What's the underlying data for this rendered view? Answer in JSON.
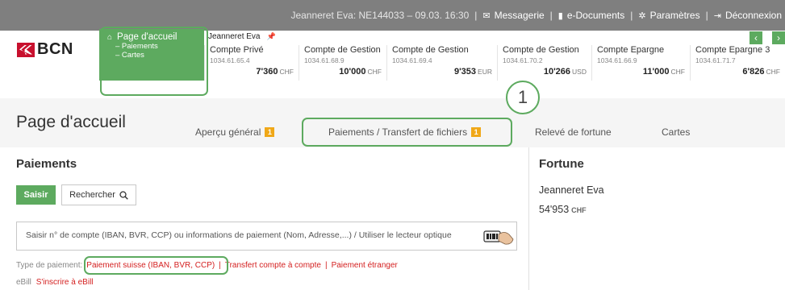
{
  "topbar": {
    "user_info": "Jeanneret Eva:  NE144033 – 09.03. 16:30",
    "separator": "|",
    "links": [
      {
        "icon": "envelope-icon",
        "label": "Messagerie"
      },
      {
        "icon": "document-icon",
        "label": "e-Documents"
      },
      {
        "icon": "gear-icon",
        "label": "Paramètres"
      },
      {
        "icon": "logout-icon",
        "label": "Déconnexion"
      }
    ]
  },
  "brand": {
    "logo_text": "BCN",
    "color": "#c8102e"
  },
  "home_menu": {
    "title": "Page d'accueil",
    "items": [
      "– Paiements",
      "– Cartes"
    ]
  },
  "account_holder": "Jeanneret Eva",
  "accounts": [
    {
      "name": "Compte Privé",
      "number": "1034.61.65.4",
      "balance": "7'360",
      "currency": "CHF"
    },
    {
      "name": "Compte de Gestion",
      "number": "1034.61.68.9",
      "balance": "10'000",
      "currency": "CHF"
    },
    {
      "name": "Compte de Gestion",
      "number": "1034.61.69.4",
      "balance": "9'353",
      "currency": "EUR"
    },
    {
      "name": "Compte de Gestion",
      "number": "1034.61.70.2",
      "balance": "10'266",
      "currency": "USD"
    },
    {
      "name": "Compte Epargne",
      "number": "1034.61.66.9",
      "balance": "11'000",
      "currency": "CHF"
    },
    {
      "name": "Compte Epargne 3",
      "number": "1034.61.71.7",
      "balance": "6'826",
      "currency": "CHF"
    }
  ],
  "nav": {
    "prev": "‹",
    "next": "›"
  },
  "step_marker": "1",
  "page": {
    "title": "Page d'accueil"
  },
  "tabs": [
    {
      "label": "Aperçu général",
      "badge": "1"
    },
    {
      "label": "Paiements / Transfert de fichiers",
      "badge": "1"
    },
    {
      "label": "Relevé de fortune",
      "badge": ""
    },
    {
      "label": "Cartes",
      "badge": ""
    }
  ],
  "payments": {
    "heading": "Paiements",
    "btn_saisir": "Saisir",
    "btn_search": "Rechercher",
    "search_placeholder": "Saisir n° de compte (IBAN, BVR, CCP) ou informations de paiement (Nom, Adresse,...) / Utiliser le lecteur optique",
    "type_label": "Type de paiement:",
    "types": [
      "Paiement suisse (IBAN, BVR, CCP)",
      "Transfert compte à compte",
      "Paiement étranger"
    ],
    "ebill_label": "eBill",
    "ebill_link": "S'inscrire à eBill"
  },
  "fortune": {
    "heading": "Fortune",
    "name": "Jeanneret Eva",
    "value": "54'953",
    "currency": "CHF"
  },
  "colors": {
    "green": "#5daa5f",
    "badge": "#f0a818",
    "link_red": "#d42020",
    "topbar": "#7f7f7f"
  }
}
